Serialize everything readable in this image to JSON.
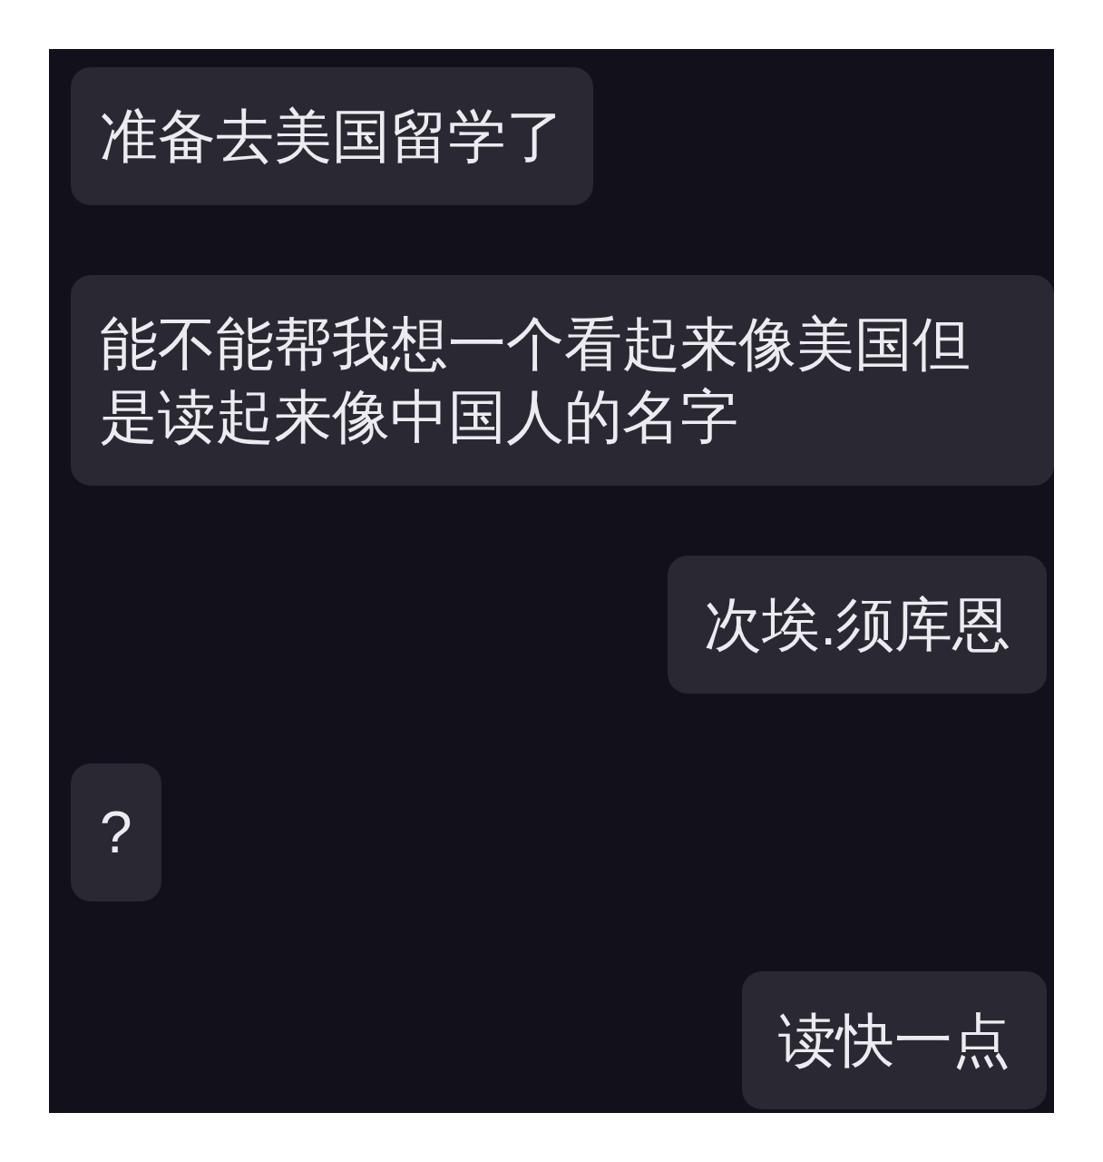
{
  "messages": [
    {
      "kind": "incoming",
      "text": "准备去美国留学了"
    },
    {
      "kind": "incoming",
      "text": "能不能帮我想一个看起来像美国但是读起来像中国人的名字"
    },
    {
      "kind": "outgoing",
      "text": "次埃.须库恩"
    },
    {
      "kind": "incoming",
      "text": "?"
    },
    {
      "kind": "outgoing",
      "text": "读快一点"
    }
  ]
}
